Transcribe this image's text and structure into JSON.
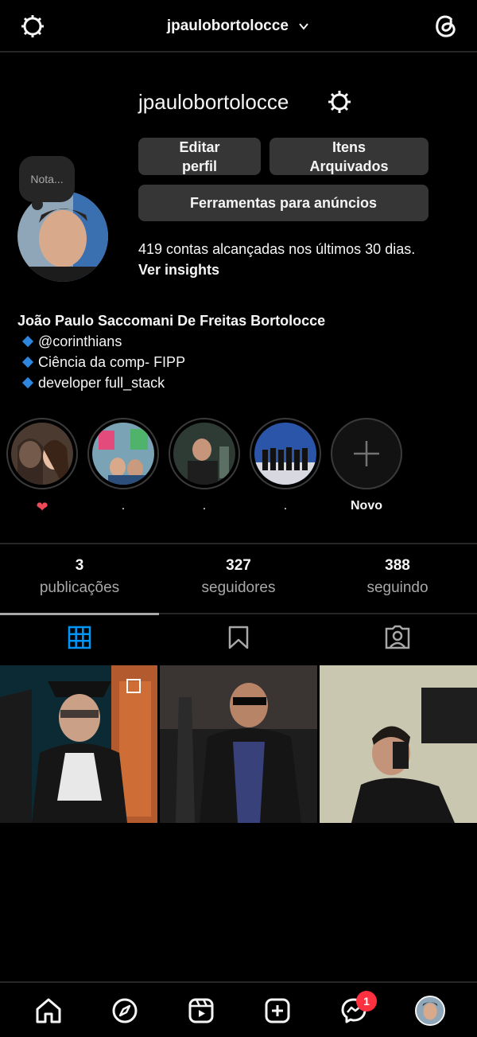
{
  "header": {
    "username": "jpaulobortolocce"
  },
  "profile": {
    "username": "jpaulobortolocce",
    "note": "Nota...",
    "buttons": {
      "edit": "Editar perfil",
      "archived": "Itens Arquivados",
      "ads": "Ferramentas para anúncios"
    },
    "insights_text": "419 contas alcançadas nos últimos 30 dias.",
    "insights_link": "Ver insights"
  },
  "bio": {
    "full_name": "João Paulo Saccomani De Freitas Bortolocce",
    "lines": [
      "@corinthians",
      "Ciência da comp- FIPP",
      "developer full_stack"
    ]
  },
  "highlights": [
    {
      "label": "❤"
    },
    {
      "label": "."
    },
    {
      "label": "."
    },
    {
      "label": "."
    },
    {
      "label": "Novo"
    }
  ],
  "stats": {
    "posts": {
      "count": "3",
      "label": "publicações"
    },
    "followers": {
      "count": "327",
      "label": "seguidores"
    },
    "following": {
      "count": "388",
      "label": "seguindo"
    }
  },
  "tabs": [
    "grid-icon",
    "bookmark-icon",
    "tagged-icon"
  ],
  "nav": {
    "items": [
      "home-icon",
      "explore-icon",
      "reels-icon",
      "create-icon",
      "messenger-icon",
      "profile-avatar"
    ],
    "messages_badge": "1"
  },
  "colors": {
    "background": "#000000",
    "button": "#363636",
    "accent": "#0095f6",
    "badge": "#ff3040",
    "bio_diamond": "#2e86de"
  }
}
